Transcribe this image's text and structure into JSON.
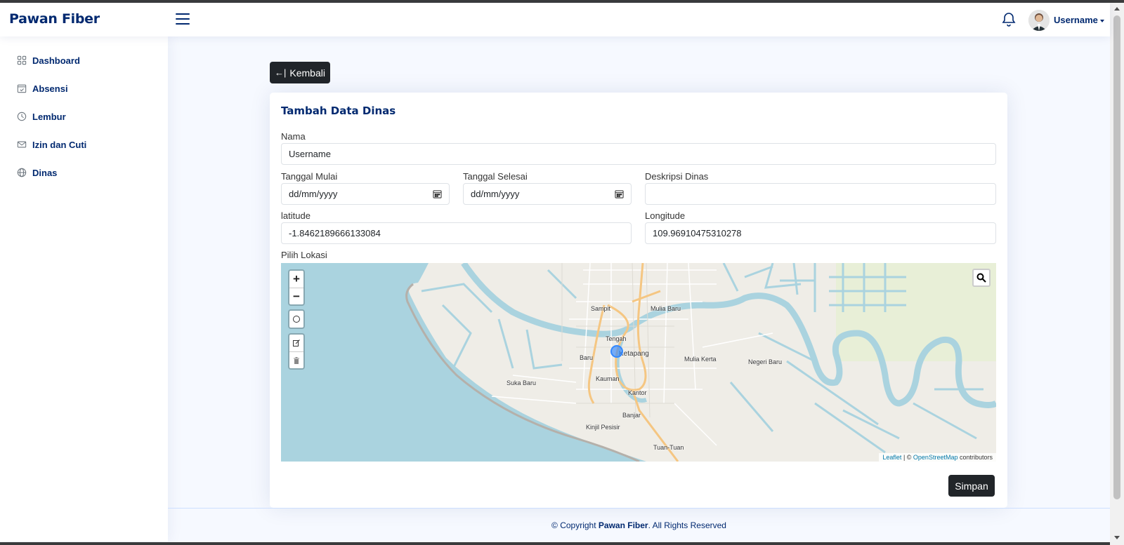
{
  "app": {
    "brand": "Pawan Fiber"
  },
  "header": {
    "username": "Username"
  },
  "sidebar": {
    "items": [
      {
        "label": "Dashboard",
        "icon": "grid-icon"
      },
      {
        "label": "Absensi",
        "icon": "calendar-check-icon"
      },
      {
        "label": "Lembur",
        "icon": "clock-icon"
      },
      {
        "label": "Izin dan Cuti",
        "icon": "envelope-icon"
      },
      {
        "label": "Dinas",
        "icon": "globe-icon"
      }
    ]
  },
  "main": {
    "back_label": "Kembali",
    "card_title": "Tambah Data Dinas",
    "form": {
      "nama_label": "Nama",
      "nama_value": "Username",
      "tanggal_mulai_label": "Tanggal Mulai",
      "tanggal_mulai_placeholder": "dd/mm/yyyy",
      "tanggal_selesai_label": "Tanggal Selesai",
      "tanggal_selesai_placeholder": "dd/mm/yyyy",
      "deskripsi_label": "Deskripsi Dinas",
      "deskripsi_value": "",
      "latitude_label": "latitude",
      "latitude_value": "-1.8462189666133084",
      "longitude_label": "Longitude",
      "longitude_value": "109.96910475310278",
      "lokasi_label": "Pilih Lokasi"
    },
    "map": {
      "zoom_in": "+",
      "zoom_out": "−",
      "places": [
        "Sampit",
        "Mulia Baru",
        "Tengah",
        "Ketapang",
        "Baru",
        "Mulia Kerta",
        "Negeri Baru",
        "Kauman",
        "Kantor",
        "Suka Baru",
        "Banjar",
        "Kinjil Pesisir",
        "Tuan-Tuan"
      ],
      "attribution": {
        "leaflet": "Leaflet",
        "sep": " | © ",
        "osm": "OpenStreetMap",
        "contributors": " contributors"
      }
    },
    "save_label": "Simpan"
  },
  "footer": {
    "prefix": "© Copyright ",
    "brand": "Pawan Fiber",
    "suffix": ". All Rights Reserved"
  },
  "colors": {
    "brand": "#012970",
    "button": "#212529",
    "water": "#aad3df",
    "land": "#efede7",
    "road": "#f5c682"
  }
}
